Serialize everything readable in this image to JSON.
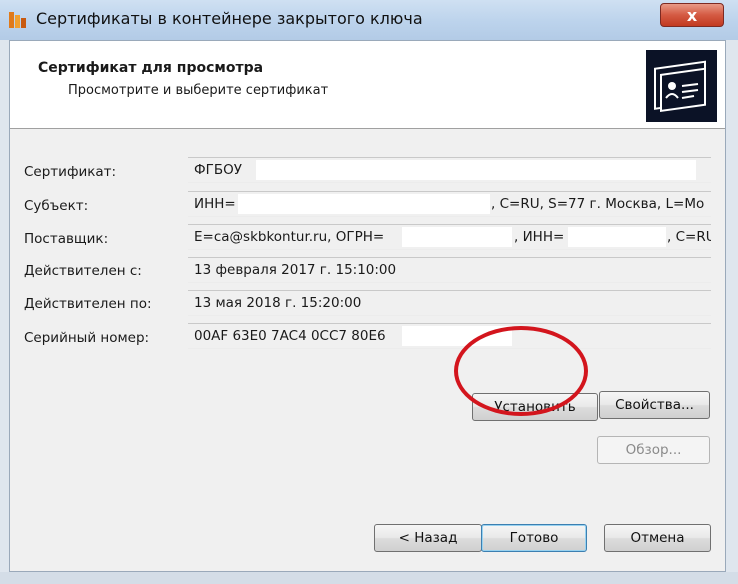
{
  "window": {
    "title": "Сертификаты в контейнере закрытого ключа",
    "close_label": "x"
  },
  "header": {
    "title": "Сертификат для просмотра",
    "subtitle": "Просмотрите и выберите сертификат",
    "icon": "certificate-icon"
  },
  "fields": {
    "certificate": {
      "label": "Сертификат:",
      "value": "ФГБОУ"
    },
    "subject": {
      "label": "Субъект:",
      "value_start": "ИНН=",
      "value_end": ", C=RU, S=77 г. Москва, L=Мо"
    },
    "issuer": {
      "label": "Поставщик:",
      "value_start": "E=ca@skbkontur.ru, ОГРН=",
      "value_mid": ", ИНН=",
      "value_end": ", C=RU"
    },
    "valid_from": {
      "label": "Действителен с:",
      "value": "13 февраля 2017 г. 15:10:00"
    },
    "valid_to": {
      "label": "Действителен по:",
      "value": "13 мая 2018 г. 15:20:00"
    },
    "serial": {
      "label": "Серийный номер:",
      "value": "00AF 63E0 7AC4 0CC7 80E6"
    }
  },
  "buttons": {
    "install": "Установить",
    "properties": "Свойства...",
    "browse": "Обзор...",
    "back": "< Назад",
    "finish": "Готово",
    "cancel": "Отмена"
  },
  "colors": {
    "highlight_circle": "#d3151d",
    "title_bar": "#bcd3ec",
    "close_button": "#c23a20"
  }
}
